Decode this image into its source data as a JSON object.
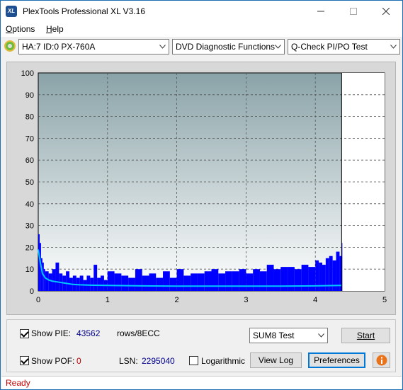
{
  "window": {
    "title": "PlexTools Professional XL V3.16",
    "app_icon_text": "XL"
  },
  "menu": {
    "options_first": "O",
    "options_rest": "ptions",
    "help_first": "H",
    "help_rest": "elp"
  },
  "toolbar": {
    "drive": "HA:7 ID:0  PX-760A",
    "function": "DVD Diagnostic Functions",
    "test": "Q-Check PI/PO Test"
  },
  "chart_data": {
    "type": "bar",
    "title": "",
    "xlabel": "",
    "ylabel": "",
    "xlim": [
      0,
      5
    ],
    "ylim": [
      0,
      100
    ],
    "x_ticks": [
      "0",
      "1",
      "2",
      "3",
      "4",
      "5"
    ],
    "y_ticks": [
      "0",
      "10",
      "20",
      "30",
      "40",
      "50",
      "60",
      "70",
      "80",
      "90",
      "100"
    ],
    "grid": true,
    "data_end_x": 4.38,
    "series": [
      {
        "kind": "PIE bars",
        "color": "#0000ff",
        "x": [
          0.0,
          0.02,
          0.04,
          0.06,
          0.08,
          0.1,
          0.15,
          0.2,
          0.25,
          0.3,
          0.35,
          0.4,
          0.45,
          0.5,
          0.55,
          0.6,
          0.65,
          0.7,
          0.75,
          0.8,
          0.85,
          0.9,
          0.95,
          1.0,
          1.1,
          1.2,
          1.3,
          1.4,
          1.5,
          1.6,
          1.7,
          1.8,
          1.9,
          2.0,
          2.1,
          2.2,
          2.3,
          2.4,
          2.5,
          2.6,
          2.7,
          2.8,
          2.9,
          3.0,
          3.1,
          3.2,
          3.3,
          3.4,
          3.5,
          3.6,
          3.7,
          3.8,
          3.9,
          4.0,
          4.05,
          4.1,
          4.15,
          4.2,
          4.25,
          4.3,
          4.35,
          4.38
        ],
        "values": [
          26,
          22,
          15,
          13,
          10,
          9,
          8,
          10,
          13,
          8,
          7,
          9,
          6,
          7,
          6,
          7,
          5,
          7,
          6,
          12,
          6,
          7,
          5,
          9,
          8,
          7,
          6,
          10,
          7,
          8,
          6,
          9,
          6,
          10,
          7,
          8,
          8,
          9,
          10,
          8,
          9,
          9,
          10,
          8,
          10,
          9,
          12,
          10,
          11,
          11,
          10,
          12,
          11,
          14,
          13,
          12,
          15,
          16,
          14,
          18,
          16,
          22
        ]
      },
      {
        "kind": "PIE trend",
        "color": "#00c8ff",
        "x": [
          0.0,
          0.03,
          0.06,
          0.1,
          0.15,
          0.2,
          0.3,
          0.4,
          0.5,
          0.6,
          0.8,
          1.0,
          1.5,
          2.0,
          2.5,
          3.0,
          3.5,
          4.0,
          4.38
        ],
        "values": [
          19,
          13,
          8,
          6,
          5,
          4.5,
          4,
          3.5,
          3,
          2.8,
          2.6,
          2.5,
          2.3,
          2.2,
          2.2,
          2.2,
          2.2,
          2.3,
          2.5
        ]
      }
    ]
  },
  "bottom": {
    "show_pie_label": "Show PIE:",
    "pie_value": "43562",
    "rows_label": "rows/8ECC",
    "show_pof_label": "Show POF:",
    "pof_value": "0",
    "lsn_label": "LSN:",
    "lsn_value": "2295040",
    "log_label": "Logarithmic",
    "test_select": "SUM8 Test",
    "start_label": "Start",
    "viewlog_label": "View Log",
    "prefs_label": "Preferences"
  },
  "status": {
    "text": "Ready"
  },
  "colors": {
    "pie_value": "#00008b",
    "pof_value": "#c00000",
    "status": "#cc0000"
  }
}
